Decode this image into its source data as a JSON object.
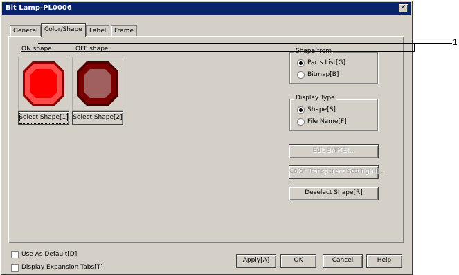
{
  "window": {
    "title": "Bit Lamp-PL0006",
    "close_icon": "close-icon"
  },
  "tabs": [
    {
      "label": "General",
      "active": false
    },
    {
      "label": "Color/Shape",
      "active": true
    },
    {
      "label": "Label",
      "active": false
    },
    {
      "label": "Frame",
      "active": false
    }
  ],
  "shapes": {
    "on_label": "ON shape",
    "off_label": "OFF shape",
    "on_button": "Select Shape[1]",
    "off_button": "Select Shape[2]",
    "on_color": "#ff0000",
    "off_color": "#7a0000"
  },
  "shape_from": {
    "legend": "Shape from",
    "options": [
      "Parts List[G]",
      "Bitmap[B]"
    ],
    "selected": 0
  },
  "display_type": {
    "legend": "Display Type",
    "options": [
      "Shape[S]",
      "File Name[F]"
    ],
    "selected": 0
  },
  "side_buttons": {
    "edit_bmp": "Edit BMP[E]...",
    "color_transparent": "Color Transparent Setting[M]...",
    "deselect": "Deselect Shape[R]"
  },
  "footer": {
    "use_default": "Use As Default[D]",
    "display_expansion": "Display Expansion Tabs[T]",
    "apply": "Apply[A]",
    "ok": "OK",
    "cancel": "Cancel",
    "help": "Help"
  },
  "callout": {
    "number": "1"
  }
}
